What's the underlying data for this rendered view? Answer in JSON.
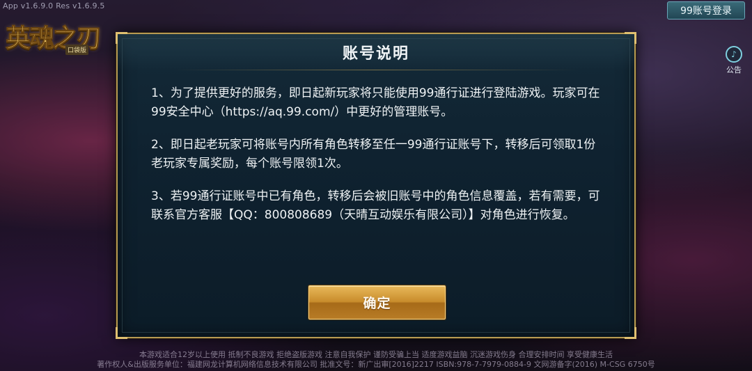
{
  "top_bar": {
    "version": "App v1.6.9.0  Res v1.6.9.5",
    "login_button": "99账号登录",
    "notice_label": "公告"
  },
  "logo": {
    "title": "英魂之刃",
    "subtitle": "口袋版"
  },
  "modal": {
    "title": "账号说明",
    "paragraphs": [
      "1、为了提供更好的服务，即日起新玩家将只能使用99通行证进行登陆游戏。玩家可在99安全中心（https://aq.99.com/）中更好的管理账号。",
      "2、即日起老玩家可将账号内所有角色转移至任一99通行证账号下，转移后可领取1份老玩家专属奖励，每个账号限领1次。",
      "3、若99通行证账号中已有角色，转移后会被旧账号中的角色信息覆盖，若有需要，可联系官方客服【QQ：800808689（天晴互动娱乐有限公司）】对角色进行恢复。"
    ],
    "confirm_label": "确定"
  },
  "footer": {
    "line1": "本游戏适合12岁以上使用  抵制不良游戏  拒绝盗版游戏  注意自我保护  谨防受骗上当  适度游戏益脑  沉迷游戏伤身  合理安排时间  享受健康生活",
    "line2": "著作权人&出版服务单位：福建网龙计算机网络信息技术有限公司  批准文号：新广出审[2016]2217  ISBN:978-7-7979-0884-9  文网游备字(2016) M-CSG 6750号"
  },
  "colors": {
    "modal_border": "#b89a52",
    "modal_bg": "#0f2230",
    "confirm_button": "#c88c2c",
    "login_button": "#2e5a68"
  },
  "icons": {
    "notice": "notice-bell-icon"
  }
}
